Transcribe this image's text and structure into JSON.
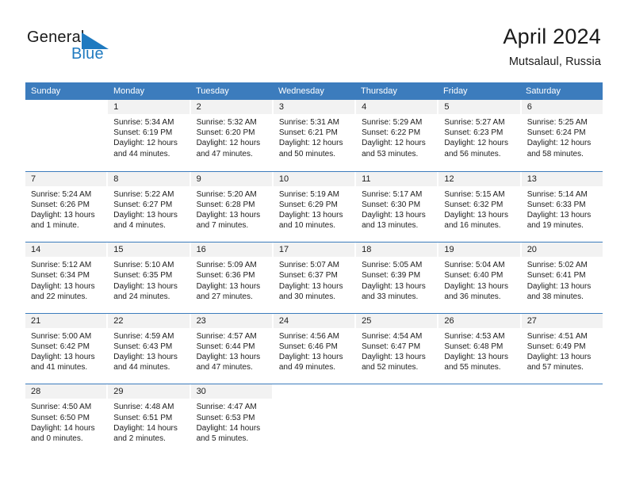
{
  "brand": {
    "name_part1": "General",
    "name_part2": "Blue",
    "triangle_color": "#1f7ac0",
    "text_color": "#1a1a1a"
  },
  "header": {
    "title": "April 2024",
    "subtitle": "Mutsalaul, Russia"
  },
  "theme": {
    "header_blue": "#3c7cbd",
    "daynum_band": "#f2f2f2",
    "text": "#202020",
    "page_background": "#ffffff"
  },
  "weekdays": [
    "Sunday",
    "Monday",
    "Tuesday",
    "Wednesday",
    "Thursday",
    "Friday",
    "Saturday"
  ],
  "weeks": [
    [
      {
        "day": "",
        "sunrise": "",
        "sunset": "",
        "daylight": ""
      },
      {
        "day": "1",
        "sunrise": "Sunrise: 5:34 AM",
        "sunset": "Sunset: 6:19 PM",
        "daylight": "Daylight: 12 hours and 44 minutes."
      },
      {
        "day": "2",
        "sunrise": "Sunrise: 5:32 AM",
        "sunset": "Sunset: 6:20 PM",
        "daylight": "Daylight: 12 hours and 47 minutes."
      },
      {
        "day": "3",
        "sunrise": "Sunrise: 5:31 AM",
        "sunset": "Sunset: 6:21 PM",
        "daylight": "Daylight: 12 hours and 50 minutes."
      },
      {
        "day": "4",
        "sunrise": "Sunrise: 5:29 AM",
        "sunset": "Sunset: 6:22 PM",
        "daylight": "Daylight: 12 hours and 53 minutes."
      },
      {
        "day": "5",
        "sunrise": "Sunrise: 5:27 AM",
        "sunset": "Sunset: 6:23 PM",
        "daylight": "Daylight: 12 hours and 56 minutes."
      },
      {
        "day": "6",
        "sunrise": "Sunrise: 5:25 AM",
        "sunset": "Sunset: 6:24 PM",
        "daylight": "Daylight: 12 hours and 58 minutes."
      }
    ],
    [
      {
        "day": "7",
        "sunrise": "Sunrise: 5:24 AM",
        "sunset": "Sunset: 6:26 PM",
        "daylight": "Daylight: 13 hours and 1 minute."
      },
      {
        "day": "8",
        "sunrise": "Sunrise: 5:22 AM",
        "sunset": "Sunset: 6:27 PM",
        "daylight": "Daylight: 13 hours and 4 minutes."
      },
      {
        "day": "9",
        "sunrise": "Sunrise: 5:20 AM",
        "sunset": "Sunset: 6:28 PM",
        "daylight": "Daylight: 13 hours and 7 minutes."
      },
      {
        "day": "10",
        "sunrise": "Sunrise: 5:19 AM",
        "sunset": "Sunset: 6:29 PM",
        "daylight": "Daylight: 13 hours and 10 minutes."
      },
      {
        "day": "11",
        "sunrise": "Sunrise: 5:17 AM",
        "sunset": "Sunset: 6:30 PM",
        "daylight": "Daylight: 13 hours and 13 minutes."
      },
      {
        "day": "12",
        "sunrise": "Sunrise: 5:15 AM",
        "sunset": "Sunset: 6:32 PM",
        "daylight": "Daylight: 13 hours and 16 minutes."
      },
      {
        "day": "13",
        "sunrise": "Sunrise: 5:14 AM",
        "sunset": "Sunset: 6:33 PM",
        "daylight": "Daylight: 13 hours and 19 minutes."
      }
    ],
    [
      {
        "day": "14",
        "sunrise": "Sunrise: 5:12 AM",
        "sunset": "Sunset: 6:34 PM",
        "daylight": "Daylight: 13 hours and 22 minutes."
      },
      {
        "day": "15",
        "sunrise": "Sunrise: 5:10 AM",
        "sunset": "Sunset: 6:35 PM",
        "daylight": "Daylight: 13 hours and 24 minutes."
      },
      {
        "day": "16",
        "sunrise": "Sunrise: 5:09 AM",
        "sunset": "Sunset: 6:36 PM",
        "daylight": "Daylight: 13 hours and 27 minutes."
      },
      {
        "day": "17",
        "sunrise": "Sunrise: 5:07 AM",
        "sunset": "Sunset: 6:37 PM",
        "daylight": "Daylight: 13 hours and 30 minutes."
      },
      {
        "day": "18",
        "sunrise": "Sunrise: 5:05 AM",
        "sunset": "Sunset: 6:39 PM",
        "daylight": "Daylight: 13 hours and 33 minutes."
      },
      {
        "day": "19",
        "sunrise": "Sunrise: 5:04 AM",
        "sunset": "Sunset: 6:40 PM",
        "daylight": "Daylight: 13 hours and 36 minutes."
      },
      {
        "day": "20",
        "sunrise": "Sunrise: 5:02 AM",
        "sunset": "Sunset: 6:41 PM",
        "daylight": "Daylight: 13 hours and 38 minutes."
      }
    ],
    [
      {
        "day": "21",
        "sunrise": "Sunrise: 5:00 AM",
        "sunset": "Sunset: 6:42 PM",
        "daylight": "Daylight: 13 hours and 41 minutes."
      },
      {
        "day": "22",
        "sunrise": "Sunrise: 4:59 AM",
        "sunset": "Sunset: 6:43 PM",
        "daylight": "Daylight: 13 hours and 44 minutes."
      },
      {
        "day": "23",
        "sunrise": "Sunrise: 4:57 AM",
        "sunset": "Sunset: 6:44 PM",
        "daylight": "Daylight: 13 hours and 47 minutes."
      },
      {
        "day": "24",
        "sunrise": "Sunrise: 4:56 AM",
        "sunset": "Sunset: 6:46 PM",
        "daylight": "Daylight: 13 hours and 49 minutes."
      },
      {
        "day": "25",
        "sunrise": "Sunrise: 4:54 AM",
        "sunset": "Sunset: 6:47 PM",
        "daylight": "Daylight: 13 hours and 52 minutes."
      },
      {
        "day": "26",
        "sunrise": "Sunrise: 4:53 AM",
        "sunset": "Sunset: 6:48 PM",
        "daylight": "Daylight: 13 hours and 55 minutes."
      },
      {
        "day": "27",
        "sunrise": "Sunrise: 4:51 AM",
        "sunset": "Sunset: 6:49 PM",
        "daylight": "Daylight: 13 hours and 57 minutes."
      }
    ],
    [
      {
        "day": "28",
        "sunrise": "Sunrise: 4:50 AM",
        "sunset": "Sunset: 6:50 PM",
        "daylight": "Daylight: 14 hours and 0 minutes."
      },
      {
        "day": "29",
        "sunrise": "Sunrise: 4:48 AM",
        "sunset": "Sunset: 6:51 PM",
        "daylight": "Daylight: 14 hours and 2 minutes."
      },
      {
        "day": "30",
        "sunrise": "Sunrise: 4:47 AM",
        "sunset": "Sunset: 6:53 PM",
        "daylight": "Daylight: 14 hours and 5 minutes."
      },
      {
        "day": "",
        "sunrise": "",
        "sunset": "",
        "daylight": ""
      },
      {
        "day": "",
        "sunrise": "",
        "sunset": "",
        "daylight": ""
      },
      {
        "day": "",
        "sunrise": "",
        "sunset": "",
        "daylight": ""
      },
      {
        "day": "",
        "sunrise": "",
        "sunset": "",
        "daylight": ""
      }
    ]
  ]
}
